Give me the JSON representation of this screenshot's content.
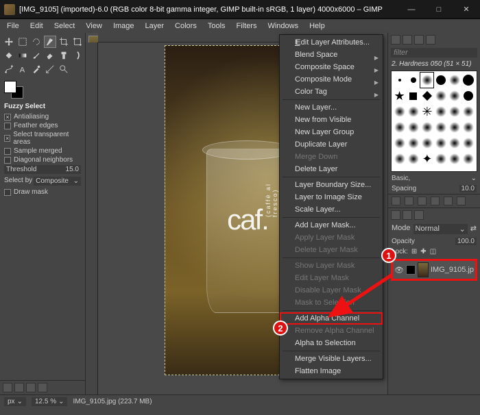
{
  "titlebar": {
    "title": "[IMG_9105] (imported)-6.0 (RGB color 8-bit gamma integer, GIMP built-in sRGB, 1 layer) 4000x6000 – GIMP"
  },
  "menubar": [
    "File",
    "Edit",
    "Select",
    "View",
    "Image",
    "Layer",
    "Colors",
    "Tools",
    "Filters",
    "Windows",
    "Help"
  ],
  "tool_options": {
    "header": "Fuzzy Select",
    "antialiasing": "Antialiasing",
    "feather": "Feather edges",
    "transparent": "Select transparent areas",
    "sample_merged": "Sample merged",
    "diagonal": "Diagonal neighbors",
    "threshold_label": "Threshold",
    "threshold_value": "15.0",
    "selectby_label": "Select by",
    "selectby_value": "Composite",
    "drawmask": "Draw mask"
  },
  "context_menu": {
    "edit_attrs": "Edit Layer Attributes...",
    "blend_space": "Blend Space",
    "composite_space": "Composite Space",
    "composite_mode": "Composite Mode",
    "color_tag": "Color Tag",
    "new_layer": "New Layer...",
    "new_from_visible": "New from Visible",
    "new_group": "New Layer Group",
    "duplicate": "Duplicate Layer",
    "merge_down": "Merge Down",
    "delete": "Delete Layer",
    "boundary": "Layer Boundary Size...",
    "to_image": "Layer to Image Size",
    "scale": "Scale Layer...",
    "add_mask": "Add Layer Mask...",
    "apply_mask": "Apply Layer Mask",
    "delete_mask": "Delete Layer Mask",
    "show_mask": "Show Layer Mask",
    "edit_mask": "Edit Layer Mask",
    "disable_mask": "Disable Layer Mask",
    "mask_to_sel": "Mask to Selection",
    "add_alpha": "Add Alpha Channel",
    "remove_alpha": "Remove Alpha Channel",
    "alpha_to_sel": "Alpha to Selection",
    "merge_visible": "Merge Visible Layers...",
    "flatten": "Flatten Image"
  },
  "right_panel": {
    "filter_placeholder": "filter",
    "brush_label": "2. Hardness 050 (51 × 51)",
    "basic": "Basic,",
    "spacing_label": "Spacing",
    "spacing_value": "10.0",
    "mode_label": "Mode",
    "mode_value": "Normal",
    "opacity_label": "Opacity",
    "opacity_value": "100.0",
    "layer_name": "IMG_9105.jp"
  },
  "annotations": {
    "one": "1",
    "two": "2"
  },
  "statusbar": {
    "unit": "px",
    "zoom": "12.5 %",
    "file_info": "IMG_9105.jpg (223.7 MB)"
  },
  "photo": {
    "brand": "caf.",
    "sub": "(caffè al fresco)"
  }
}
